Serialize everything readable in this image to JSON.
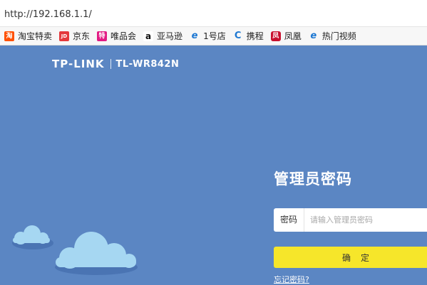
{
  "browser": {
    "address": "http://192.168.1.1/"
  },
  "bookmarks": [
    {
      "label": "淘宝特卖",
      "icon": "taobao-icon",
      "glyph": "淘"
    },
    {
      "label": "京东",
      "icon": "jd-icon",
      "glyph": "JD"
    },
    {
      "label": "唯品会",
      "icon": "vip-icon",
      "glyph": "特"
    },
    {
      "label": "亚马逊",
      "icon": "amazon-icon",
      "glyph": "a"
    },
    {
      "label": "1号店",
      "icon": "ie-icon",
      "glyph": "e"
    },
    {
      "label": "携程",
      "icon": "ctrip-icon",
      "glyph": "C"
    },
    {
      "label": "凤凰",
      "icon": "ifeng-icon",
      "glyph": "凤"
    },
    {
      "label": "热门视频",
      "icon": "ie-icon",
      "glyph": "e"
    }
  ],
  "router": {
    "brand": "TP-LINK",
    "model": "TL-WR842N",
    "title": "管理员密码",
    "password_label": "密码",
    "password_placeholder": "请输入管理员密码",
    "confirm_label": "确定",
    "forgot_label": "忘记密码?",
    "bg_color": "#5b86c3",
    "button_color": "#f6e62a"
  }
}
